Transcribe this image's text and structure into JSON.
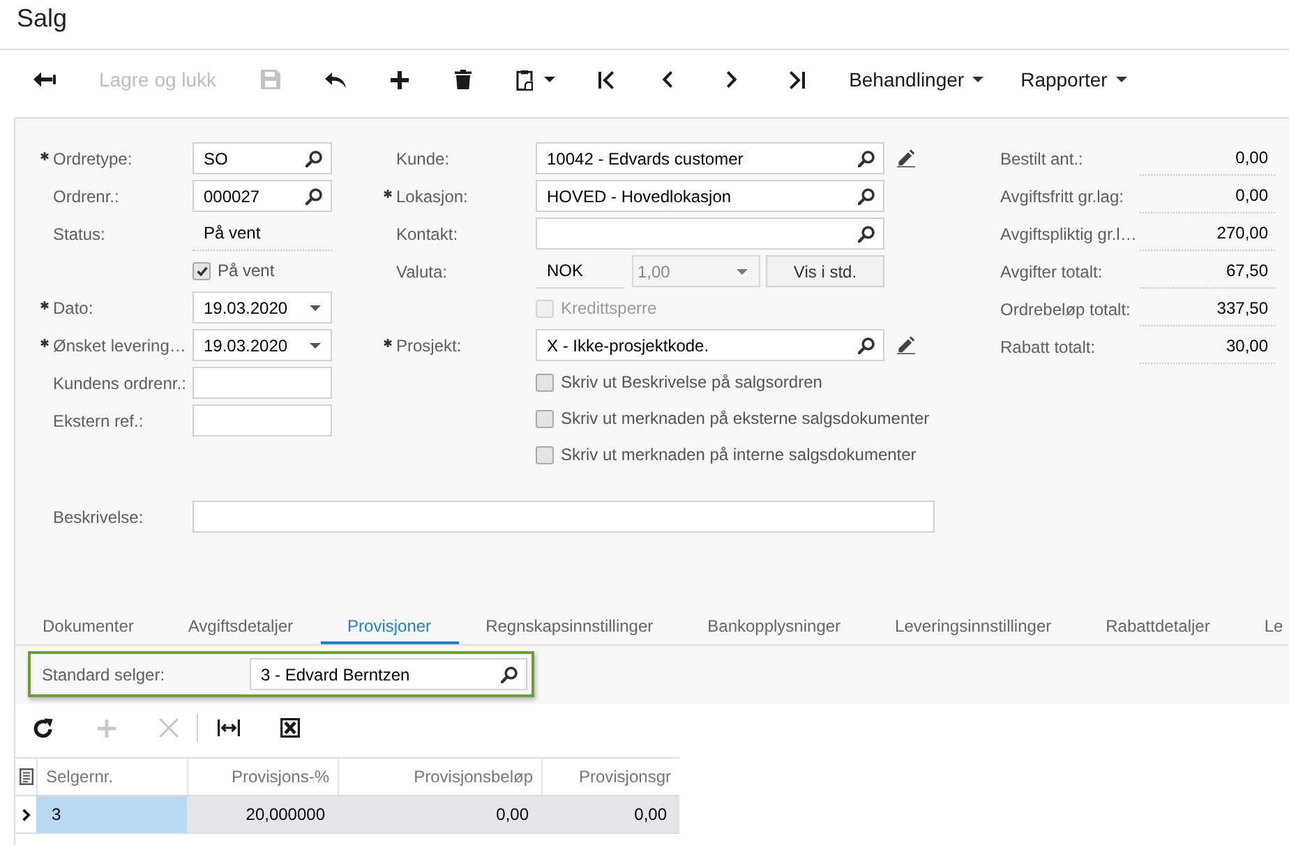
{
  "window": {
    "title": "Salg"
  },
  "toolbar": [
    {
      "kind": "back",
      "disabled": false
    },
    {
      "kind": "text",
      "label": "Lagre og lukk",
      "disabled": true
    },
    {
      "kind": "save",
      "disabled": true
    },
    {
      "kind": "undo",
      "disabled": false
    },
    {
      "kind": "add",
      "disabled": false
    },
    {
      "kind": "delete",
      "disabled": false
    },
    {
      "kind": "paste",
      "disabled": false
    },
    {
      "kind": "first",
      "disabled": false
    },
    {
      "kind": "previous",
      "disabled": false
    },
    {
      "kind": "next",
      "disabled": false
    },
    {
      "kind": "last",
      "disabled": false
    },
    {
      "kind": "menu",
      "label": "Behandlinger"
    },
    {
      "kind": "menu",
      "label": "Rapporter"
    }
  ],
  "order_fields": [
    {
      "kind": "lookup",
      "label": "Ordretype:",
      "required": true,
      "value": "SO"
    },
    {
      "kind": "lookup",
      "label": "Ordrenr.:",
      "required": false,
      "value": "000027"
    },
    {
      "kind": "readonly",
      "label": "Status:",
      "required": false,
      "value": "På vent"
    },
    {
      "kind": "checkbox",
      "label": "På vent",
      "checked": true
    },
    {
      "kind": "date",
      "label": "Dato:",
      "required": true,
      "value": "19.03.2020"
    },
    {
      "kind": "date",
      "label": "Ønsket levering…",
      "required": true,
      "value": "19.03.2020"
    },
    {
      "kind": "text",
      "label": "Kundens ordrenr.:",
      "required": false
    },
    {
      "kind": "text",
      "label": "Ekstern ref.:",
      "required": false
    }
  ],
  "customer_fields": [
    {
      "kind": "lookup",
      "label": "Kunde:",
      "required": false,
      "value": "10042 - Edvards customer",
      "edit_button": true
    },
    {
      "kind": "lookup",
      "label": "Lokasjon:",
      "required": true,
      "value": "HOVED - Hovedlokasjon",
      "edit_button": false
    },
    {
      "kind": "lookup",
      "label": "Kontakt:",
      "required": false,
      "edit_button": false
    },
    {
      "kind": "currency",
      "label": "Valuta:",
      "required": false,
      "value": "NOK",
      "rate": "1,00",
      "button": "Vis i std."
    },
    {
      "kind": "checkbox",
      "label": "Kredittsperre",
      "checked": false,
      "disabled": true
    },
    {
      "kind": "lookup",
      "label": "Prosjekt:",
      "required": true,
      "value": "X - Ikke-prosjektkode.",
      "edit_button": true
    },
    {
      "kind": "checkbox",
      "label": "Skriv ut Beskrivelse på salgsordren",
      "checked": false,
      "disabled": false
    },
    {
      "kind": "checkbox",
      "label": "Skriv ut merknaden på eksterne salgsdokumenter",
      "checked": false,
      "disabled": false
    },
    {
      "kind": "checkbox",
      "label": "Skriv ut merknaden på interne salgsdokumenter",
      "checked": false,
      "disabled": false
    }
  ],
  "totals": [
    {
      "label": "Bestilt ant.:",
      "value": "0,00"
    },
    {
      "label": "Avgiftsfritt gr.lag:",
      "value": "0,00"
    },
    {
      "label": "Avgiftspliktig gr.l…",
      "value": "270,00"
    },
    {
      "label": "Avgifter totalt:",
      "value": "67,50"
    },
    {
      "label": "Ordrebeløp totalt:",
      "value": "337,50"
    },
    {
      "label": "Rabatt totalt:",
      "value": "30,00"
    }
  ],
  "description": {
    "label": "Beskrivelse:"
  },
  "tabs": [
    {
      "label": "Dokumenter",
      "selected": false
    },
    {
      "label": "Avgiftsdetaljer",
      "selected": false
    },
    {
      "label": "Provisjoner",
      "selected": true
    },
    {
      "label": "Regnskapsinnstillinger",
      "selected": false
    },
    {
      "label": "Bankopplysninger",
      "selected": false
    },
    {
      "label": "Leveringsinnstillinger",
      "selected": false
    },
    {
      "label": "Rabattdetaljer",
      "selected": false
    },
    {
      "label": "Le",
      "selected": false
    }
  ],
  "salesperson": {
    "label": "Standard selger:",
    "value": "3 - Edvard Berntzen"
  },
  "grid": {
    "toolbar": [
      {
        "kind": "refresh",
        "disabled": false
      },
      {
        "kind": "add",
        "disabled": true
      },
      {
        "kind": "delete",
        "disabled": true
      },
      {
        "kind": "separator"
      },
      {
        "kind": "fit",
        "disabled": false
      },
      {
        "kind": "export",
        "disabled": false
      }
    ],
    "columns": [
      "Selgernr.",
      "Provisjons-%",
      "Provisjonsbeløp",
      "Provisjonsgr"
    ],
    "rows": [
      {
        "selected": true,
        "cells": [
          "3",
          "20,000000",
          "0,00",
          "0,00"
        ]
      }
    ]
  }
}
